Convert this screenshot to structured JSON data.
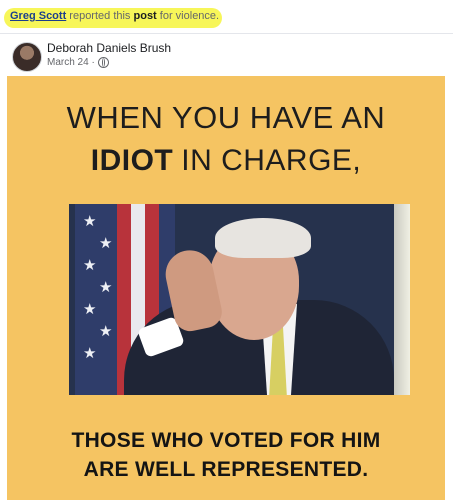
{
  "report": {
    "reporter": "Greg Scott",
    "text1": " reported this ",
    "post_word": "post",
    "text2": " for violence."
  },
  "post": {
    "author": "Deborah Daniels Brush",
    "date": "March 24 ·",
    "privacy_icon": "globe-icon"
  },
  "meme": {
    "line1": "WHEN YOU HAVE AN",
    "line2_bold": "IDIOT",
    "line2_rest": "IN CHARGE,",
    "line3": "THOSE WHO VOTED FOR HIM",
    "line4": "ARE WELL REPRESENTED."
  },
  "colors": {
    "meme_background": "#f5c462",
    "highlight": "#f6f53c"
  }
}
